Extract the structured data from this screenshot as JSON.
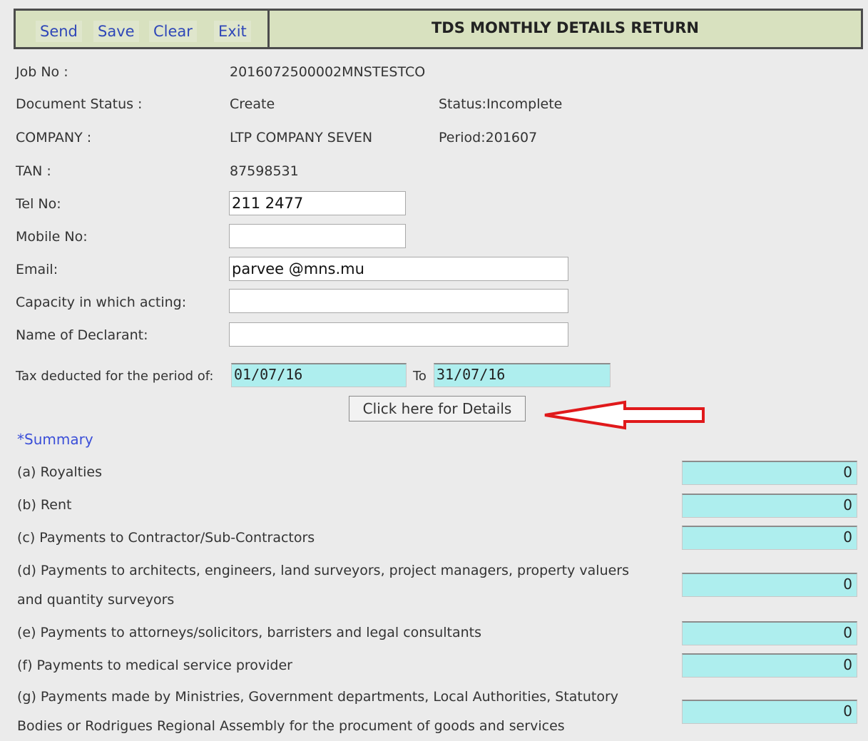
{
  "toolbar": {
    "send": "Send",
    "save": "Save",
    "clear": "Clear",
    "exit": "Exit"
  },
  "page_title": "TDS MONTHLY DETAILS RETURN",
  "fields": {
    "job_no_label": "Job No :",
    "job_no_value": "2016072500002MNSTESTCO",
    "doc_status_label": "Document Status :",
    "doc_status_value": "Create",
    "status": "Status:Incomplete",
    "company_label": "COMPANY :",
    "company_value": "LTP COMPANY SEVEN",
    "period": "Period:201607",
    "tan_label": "TAN :",
    "tan_value": "87598531",
    "tel_label": "Tel No:",
    "tel_value": "211 2477",
    "mobile_label": "Mobile No:",
    "mobile_value": "",
    "email_label": "Email:",
    "email_value": "parvee @mns.mu",
    "capacity_label": "Capacity in which acting:",
    "capacity_value": "",
    "declarant_label": "Name of Declarant:",
    "declarant_value": "",
    "period_label": "Tax deducted for the period of:",
    "period_from": "01/07/16",
    "to_label": "To",
    "period_to": "31/07/16"
  },
  "details_button": "Click here for Details",
  "summary": {
    "title": "*Summary",
    "items": [
      {
        "line1": "(a) Royalties",
        "line2": "",
        "amount": "0"
      },
      {
        "line1": "(b) Rent",
        "line2": "",
        "amount": "0"
      },
      {
        "line1": "(c) Payments to Contractor/Sub-Contractors",
        "line2": "",
        "amount": "0"
      },
      {
        "line1": "(d) Payments to architects, engineers, land surveyors, project managers, property valuers",
        "line2": "and quantity surveyors",
        "amount": "0"
      },
      {
        "line1": "(e) Payments to attorneys/solicitors, barristers and legal consultants",
        "line2": "",
        "amount": "0"
      },
      {
        "line1": "(f) Payments to medical service provider",
        "line2": "",
        "amount": "0"
      },
      {
        "line1": "(g) Payments made by Ministries, Government departments, Local Authorities, Statutory",
        "line2": "Bodies or Rodrigues Regional Assembly for the procument of goods and services",
        "amount": "0"
      }
    ]
  },
  "colors": {
    "header_bg": "#d8e1bf",
    "link_blue": "#2f47b8",
    "cyan_field": "#aeeeee",
    "arrow_red": "#e0191b"
  }
}
